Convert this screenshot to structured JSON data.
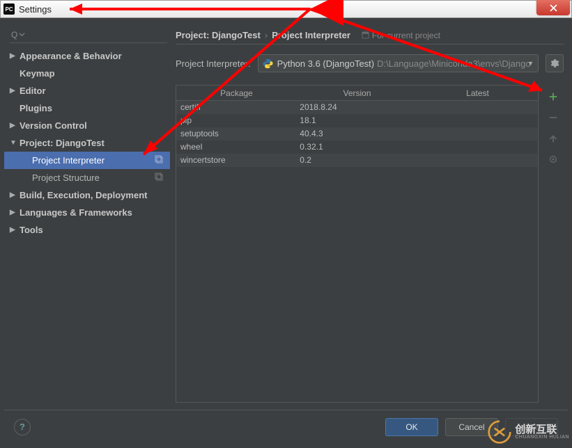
{
  "window": {
    "title": "Settings"
  },
  "sidebar": {
    "search_placeholder": "",
    "items": [
      {
        "label": "Appearance & Behavior",
        "bold": true,
        "arrow": "▶"
      },
      {
        "label": "Keymap",
        "bold": true
      },
      {
        "label": "Editor",
        "bold": true,
        "arrow": "▶"
      },
      {
        "label": "Plugins",
        "bold": true
      },
      {
        "label": "Version Control",
        "bold": true,
        "arrow": "▶"
      },
      {
        "label": "Project: DjangoTest",
        "bold": true,
        "arrow": "▼"
      },
      {
        "label": "Project Interpreter",
        "sub": true,
        "selected": true,
        "copy": true
      },
      {
        "label": "Project Structure",
        "sub": true,
        "copy": true
      },
      {
        "label": "Build, Execution, Deployment",
        "bold": true,
        "arrow": "▶"
      },
      {
        "label": "Languages & Frameworks",
        "bold": true,
        "arrow": "▶"
      },
      {
        "label": "Tools",
        "bold": true,
        "arrow": "▶"
      }
    ]
  },
  "breadcrumb": {
    "root": "Project: DjangoTest",
    "leaf": "Project Interpreter",
    "tag": "For current project"
  },
  "interpreter": {
    "label": "Project Interpreter:",
    "name": "Python 3.6 (DjangoTest)",
    "path": "D:\\Language\\Miniconda3\\envs\\Django"
  },
  "table": {
    "headers": [
      "Package",
      "Version",
      "Latest"
    ],
    "rows": [
      {
        "pkg": "certifi",
        "ver": "2018.8.24",
        "latest": ""
      },
      {
        "pkg": "pip",
        "ver": "18.1",
        "latest": ""
      },
      {
        "pkg": "setuptools",
        "ver": "40.4.3",
        "latest": ""
      },
      {
        "pkg": "wheel",
        "ver": "0.32.1",
        "latest": ""
      },
      {
        "pkg": "wincertstore",
        "ver": "0.2",
        "latest": ""
      }
    ]
  },
  "buttons": {
    "ok": "OK",
    "cancel": "Cancel",
    "apply": "Apply"
  },
  "watermark": {
    "text": "创新互联",
    "sub": "CHUANGXIN HULIAN"
  }
}
